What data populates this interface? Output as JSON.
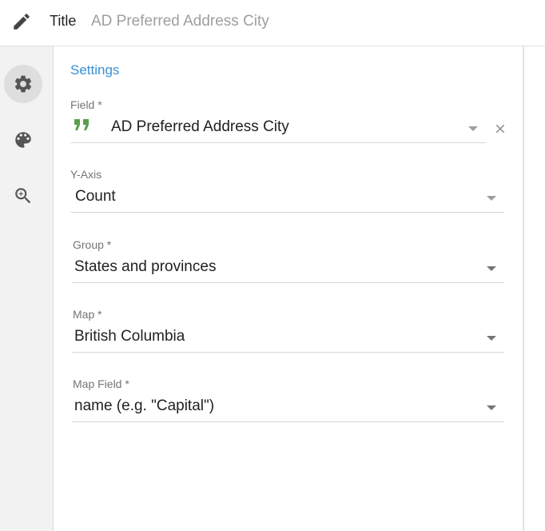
{
  "header": {
    "title_label": "Title",
    "title_value": "AD Preferred Address City"
  },
  "sidebar": {
    "items": [
      {
        "icon": "gear-icon",
        "active": true
      },
      {
        "icon": "palette-icon",
        "active": false
      },
      {
        "icon": "zoom-in-icon",
        "active": false
      }
    ]
  },
  "settings": {
    "section_title": "Settings",
    "field": {
      "label": "Field *",
      "value": "AD Preferred Address City",
      "icon": "quote-icon"
    },
    "y_axis": {
      "label": "Y-Axis",
      "value": "Count"
    },
    "group": {
      "label": "Group *",
      "value": "States and provinces"
    },
    "map": {
      "label": "Map *",
      "value": "British Columbia"
    },
    "map_field": {
      "label": "Map Field *",
      "value": "name (e.g. \"Capital\")"
    }
  },
  "colors": {
    "accent": "#3a8fd6",
    "quote_icon": "#5a9e4b",
    "sidebar_bg": "#f2f2f2"
  }
}
